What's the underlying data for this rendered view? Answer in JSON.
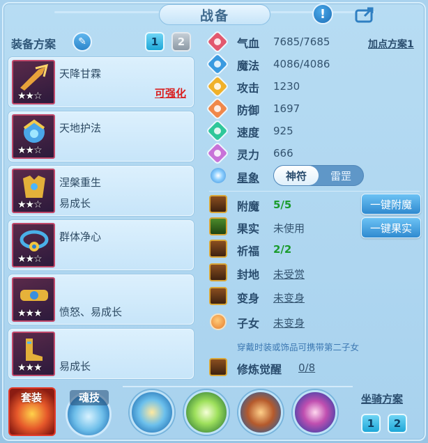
{
  "header": {
    "title": "战备"
  },
  "scheme": {
    "label": "装备方案",
    "tabs": [
      "1",
      "2"
    ]
  },
  "equipment": [
    {
      "name": "天降甘霖",
      "sub": "",
      "enhance": "可强化",
      "stars": "★★☆"
    },
    {
      "name": "天地护法",
      "sub": "",
      "enhance": "",
      "stars": "★★☆"
    },
    {
      "name": "涅槃重生",
      "sub": "易成长",
      "enhance": "",
      "stars": "★★☆"
    },
    {
      "name": "群体净心",
      "sub": "",
      "enhance": "",
      "stars": "★★☆"
    },
    {
      "name": "",
      "sub": "愤怒、易成长",
      "enhance": "",
      "stars": "★★★"
    },
    {
      "name": "",
      "sub": "易成长",
      "enhance": "",
      "stars": "★★★"
    }
  ],
  "stats": [
    {
      "label": "气血",
      "value": "7685/7685",
      "color": "#e2586e"
    },
    {
      "label": "魔法",
      "value": "4086/4086",
      "color": "#3a9ae0"
    },
    {
      "label": "攻击",
      "value": "1230",
      "color": "#f0b12a"
    },
    {
      "label": "防御",
      "value": "1697",
      "color": "#f0884a"
    },
    {
      "label": "速度",
      "value": "925",
      "color": "#2fc79a"
    },
    {
      "label": "灵力",
      "value": "666",
      "color": "#c872d8"
    }
  ],
  "addpoint_label": "加点方案1",
  "astro": {
    "label": "星象",
    "options": [
      "神符",
      "雷罡"
    ]
  },
  "features": [
    {
      "label": "附魔",
      "value": "5/5"
    },
    {
      "label": "果实",
      "value": "未使用"
    },
    {
      "label": "祈福",
      "value": "2/2"
    },
    {
      "label": "封地",
      "value": "未受赏"
    },
    {
      "label": "变身",
      "value": "未变身"
    },
    {
      "label": "子女",
      "value": "未变身"
    }
  ],
  "buttons": {
    "enchant": "一键附魔",
    "fruit": "一键果实"
  },
  "hint": "穿戴时装或饰品可携带第二子女",
  "cultivation": {
    "label": "修炼觉醒",
    "value": "0/8"
  },
  "bottom": {
    "suit_label": "套装",
    "soul_label": "魂技",
    "mount_label": "坐骑方案",
    "mount_tabs": [
      "1",
      "2"
    ]
  }
}
